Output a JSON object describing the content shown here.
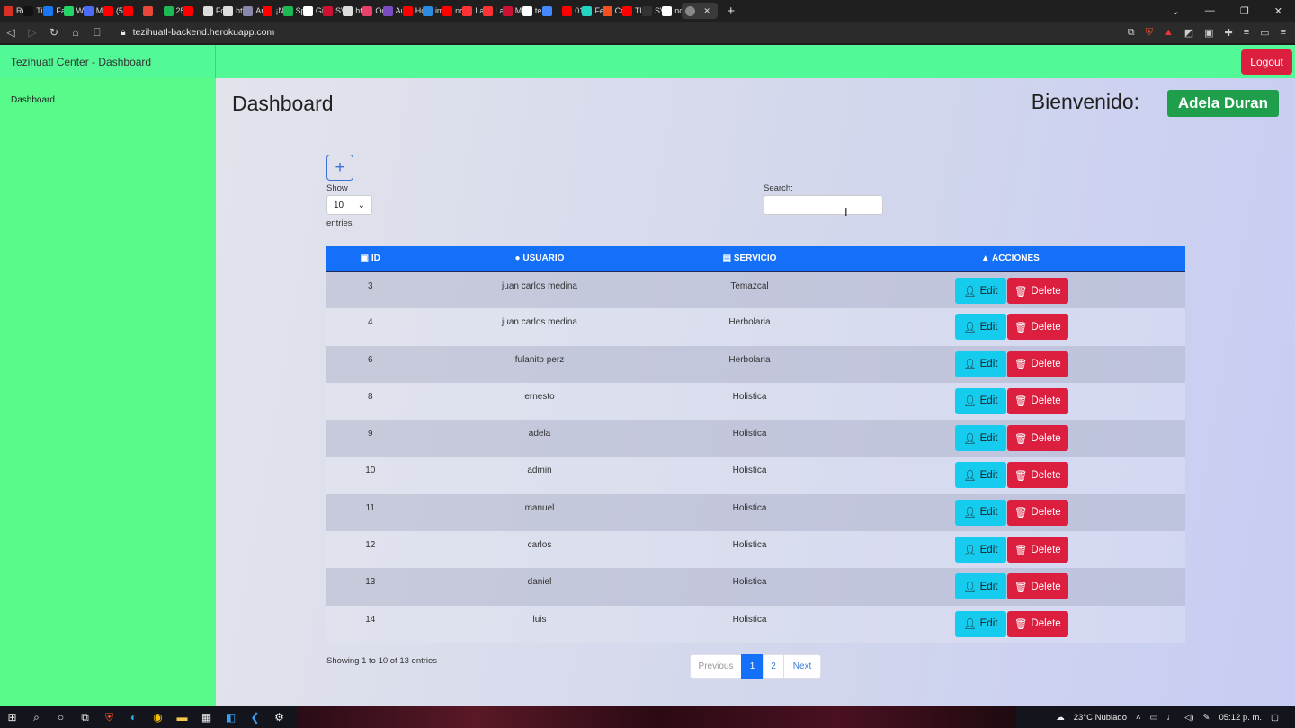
{
  "browser": {
    "tabs": [
      {
        "label": "Re",
        "color": "#d93025"
      },
      {
        "label": "Tik",
        "color": "#111111"
      },
      {
        "label": "Fac",
        "color": "#1877f2"
      },
      {
        "label": "Wh",
        "color": "#25d366"
      },
      {
        "label": "Me",
        "color": "#4a6cf7"
      },
      {
        "label": "(59",
        "color": "#ff0000"
      },
      {
        "label": "",
        "color": "#ff0000"
      },
      {
        "label": "",
        "color": "#e8483a"
      },
      {
        "label": "25",
        "color": "#1db954"
      },
      {
        "label": "",
        "color": "#ff0000"
      },
      {
        "label": "For",
        "color": "#dddddd"
      },
      {
        "label": "htt",
        "color": "#dddddd"
      },
      {
        "label": "Are",
        "color": "#8888aa"
      },
      {
        "label": "¡No",
        "color": "#ff0000"
      },
      {
        "label": "Spo",
        "color": "#1db954"
      },
      {
        "label": "Git",
        "color": "#ffffff"
      },
      {
        "label": "SVC",
        "color": "#cc1133"
      },
      {
        "label": "htt",
        "color": "#dddddd"
      },
      {
        "label": "Od",
        "color": "#e8426a"
      },
      {
        "label": "Au",
        "color": "#7a4cc2"
      },
      {
        "label": "Ho",
        "color": "#ff0000"
      },
      {
        "label": "im",
        "color": "#2a8cde"
      },
      {
        "label": "no",
        "color": "#ff0000"
      },
      {
        "label": "La",
        "color": "#ff3333"
      },
      {
        "label": "La",
        "color": "#ff3333"
      },
      {
        "label": "MI",
        "color": "#cc1133"
      },
      {
        "label": "tez",
        "color": "#ffffff"
      },
      {
        "label": "",
        "color": "#4488ff"
      },
      {
        "label": "01",
        "color": "#ff0000"
      },
      {
        "label": "Fe",
        "color": "#25d3c0"
      },
      {
        "label": "Co",
        "color": "#f25022"
      },
      {
        "label": "TU",
        "color": "#ff0000"
      },
      {
        "label": "SVC",
        "color": "#333333"
      },
      {
        "label": "no",
        "color": "#ffffff"
      }
    ],
    "new_tab": "+",
    "url": "tezihuatl-backend.herokuapp.com"
  },
  "app": {
    "brand": "Tezihuatl Center - Dashboard",
    "logout": "Logout",
    "sidebar": {
      "items": [
        {
          "label": "Dashboard"
        }
      ]
    },
    "title": "Dashboard",
    "welcome": "Bienvenido:",
    "user": "Adela Duran",
    "add": "+",
    "show_label": "Show",
    "entries_per_page": "10",
    "entries_label": "entries",
    "search_label": "Search:",
    "columns": {
      "id": "ID",
      "usuario": "USUARIO",
      "servicio": "SERVICIO",
      "acciones": "ACCIONES"
    },
    "edit_label": "Edit",
    "delete_label": "Delete",
    "rows": [
      {
        "id": "3",
        "usuario": "juan carlos medina",
        "servicio": "Temazcal"
      },
      {
        "id": "4",
        "usuario": "juan carlos medina",
        "servicio": "Herbolaria"
      },
      {
        "id": "6",
        "usuario": "fulanito perz",
        "servicio": "Herbolaria"
      },
      {
        "id": "8",
        "usuario": "ernesto",
        "servicio": "Holistica"
      },
      {
        "id": "9",
        "usuario": "adela",
        "servicio": "Holistica"
      },
      {
        "id": "10",
        "usuario": "admin",
        "servicio": "Holistica"
      },
      {
        "id": "11",
        "usuario": "manuel",
        "servicio": "Holistica"
      },
      {
        "id": "12",
        "usuario": "carlos",
        "servicio": "Holistica"
      },
      {
        "id": "13",
        "usuario": "daniel",
        "servicio": "Holistica"
      },
      {
        "id": "14",
        "usuario": "luis",
        "servicio": "Holistica"
      }
    ],
    "info": "Showing 1 to 10 of 13 entries",
    "pager": {
      "previous": "Previous",
      "page1": "1",
      "page2": "2",
      "next": "Next"
    }
  },
  "taskbar": {
    "weather": "23°C  Nublado",
    "time": "05:12 p. m."
  },
  "colors": {
    "topbar": "#52f996",
    "sidebar": "#58fb89",
    "primary": "#1470f9",
    "danger": "#dc1f3f",
    "info": "#15cbee",
    "success": "#1f9e4b"
  }
}
